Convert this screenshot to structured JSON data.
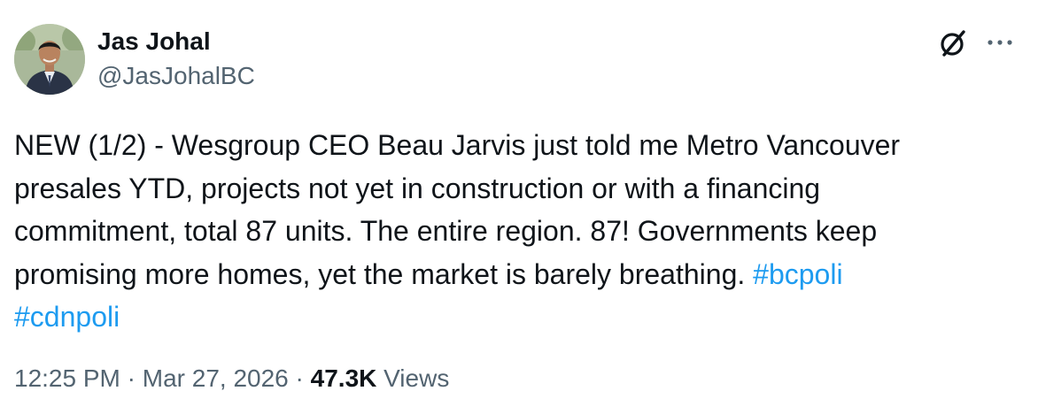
{
  "author": {
    "display_name": "Jas Johal",
    "handle": "@JasJohalBC"
  },
  "icons": {
    "platform": "grok-icon",
    "menu": "more-icon"
  },
  "tweet": {
    "line1": "NEW (1/2) - Wesgroup CEO Beau Jarvis just told me Metro Vancouver",
    "line2": "presales YTD, projects not yet in construction or with a financing",
    "line3": "commitment, total 87 units. The entire region. 87! Governments keep",
    "line4": "promising more homes, yet the market is barely breathing.",
    "hashtags": [
      "#bcpoli",
      "#cdnpoli"
    ]
  },
  "meta": {
    "time": "12:25 PM",
    "separator": "·",
    "date": "Mar 27, 2026",
    "views_count": "47.3K",
    "views_label": "Views"
  },
  "colors": {
    "text": "#0f1419",
    "secondary": "#536471",
    "link": "#1d9bf0"
  }
}
